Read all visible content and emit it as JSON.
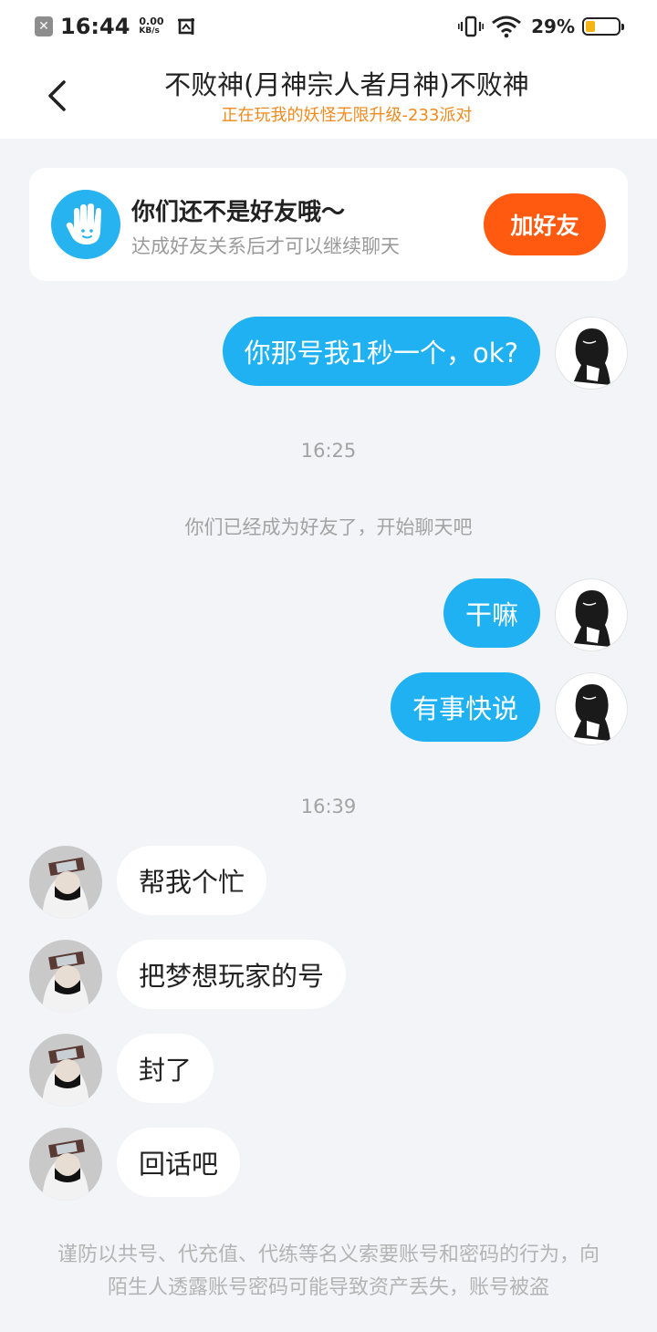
{
  "status_bar": {
    "time": "16:44",
    "speed_value": "0.00",
    "speed_unit": "KB/s",
    "battery_percent": "29%",
    "battery_level": 0.29,
    "battery_color": "#f3b414"
  },
  "header": {
    "title": "不败神(月神宗人者月神)不败神",
    "subtitle": "正在玩我的妖怪无限升级-233派对"
  },
  "friend_card": {
    "title": "你们还不是好友哦～",
    "subtitle": "达成好友关系后才可以继续聊天",
    "button_label": "加好友",
    "button_color": "#ff5a10"
  },
  "messages": [
    {
      "side": "me",
      "text": "你那号我1秒一个，ok?"
    },
    {
      "side": "me",
      "text": "干嘛"
    },
    {
      "side": "me",
      "text": "有事快说"
    },
    {
      "side": "other",
      "text": "帮我个忙"
    },
    {
      "side": "other",
      "text": "把梦想玩家的号"
    },
    {
      "side": "other",
      "text": "封了"
    },
    {
      "side": "other",
      "text": "回话吧"
    }
  ],
  "timestamps": [
    "16:25",
    "16:39"
  ],
  "system_notice": "你们已经成为好友了，开始聊天吧",
  "warning_text": "谨防以共号、代充值、代练等名义索要账号和密码的行为，向陌生人透露账号密码可能导致资产丢失，账号被盗",
  "colors": {
    "my_bubble": "#1fb1f1",
    "other_bubble": "#ffffff",
    "background": "#f2f4f7",
    "subtitle": "#f08a1e"
  }
}
